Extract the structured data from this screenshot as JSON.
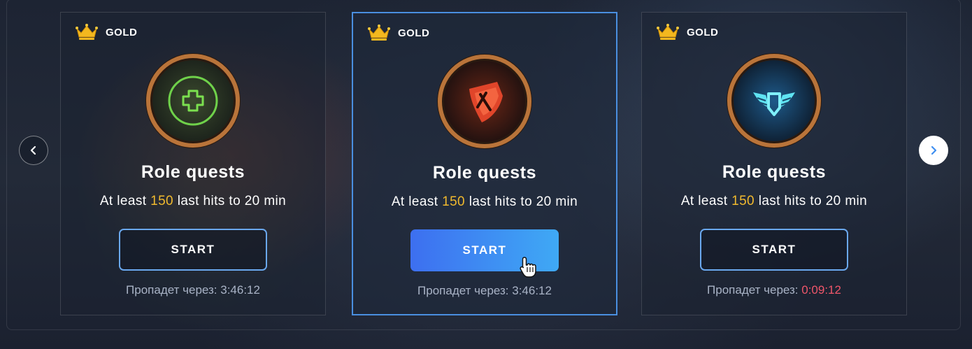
{
  "carousel": {
    "prev_icon": "chevron-left-icon",
    "next_icon": "chevron-right-icon",
    "colors": {
      "accent": "#4a8fe0",
      "button_gradient_start": "#3d6ff0",
      "button_gradient_end": "#3fa9f5",
      "highlight": "#f0b92e",
      "warning": "#f0566a"
    }
  },
  "cards": [
    {
      "tier": "GOLD",
      "tier_icon": "crown-icon",
      "emblem": "support-cross-icon",
      "title": "Role quests",
      "desc_prefix": "At least ",
      "desc_value": "150",
      "desc_suffix": " last hits to 20 min",
      "button": "START",
      "expires_label": "Пропадет через: ",
      "expires_time": "3:46:12"
    },
    {
      "tier": "GOLD",
      "tier_icon": "crown-icon",
      "emblem": "fighter-shield-icon",
      "title": "Role quests",
      "desc_prefix": "At least ",
      "desc_value": "150",
      "desc_suffix": " last hits to 20 min",
      "button": "START",
      "expires_label": "Пропадет через: ",
      "expires_time": "3:46:12"
    },
    {
      "tier": "GOLD",
      "tier_icon": "crown-icon",
      "emblem": "winged-crest-icon",
      "title": "Role quests",
      "desc_prefix": "At least ",
      "desc_value": "150",
      "desc_suffix": " last hits to 20 min",
      "button": "START",
      "expires_label": "Пропадет через: ",
      "expires_time": "0:09:12"
    }
  ]
}
